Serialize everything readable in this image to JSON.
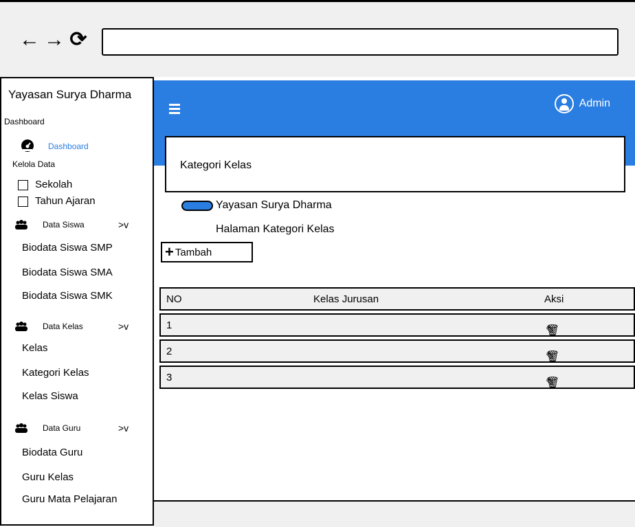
{
  "browser": {
    "back_icon": "←",
    "forward_icon": "→",
    "reload_icon": "⟳",
    "url": ""
  },
  "sidebar": {
    "brand": "Yayasan Surya Dharma",
    "section_dashboard": "Dashboard",
    "dashboard_link": "Dashboard",
    "section_kelola": "Kelola Data",
    "items_top": [
      "Sekolah",
      "Tahun Ajaran"
    ],
    "group_siswa": {
      "label": "Data Siswa",
      "chevron": ">v",
      "items": [
        "Biodata Siswa SMP",
        "Biodata Siswa SMA",
        "Biodata Siswa SMK"
      ]
    },
    "group_kelas": {
      "label": "Data Kelas",
      "chevron": ">v",
      "items": [
        "Kelas",
        "Kategori Kelas",
        "Kelas Siswa"
      ]
    },
    "group_guru": {
      "label": "Data Guru",
      "chevron": ">v",
      "items": [
        "Biodata Guru",
        "Guru Kelas",
        "Guru Mata Pelajaran"
      ]
    }
  },
  "header": {
    "admin_label": "Admin",
    "accent_color": "#2a7de1"
  },
  "page": {
    "title": "Kategori Kelas",
    "breadcrumb": [
      "Yayasan Surya Dharma",
      "Halaman Kategori Kelas"
    ],
    "add_button": "Tambah"
  },
  "table": {
    "headers": [
      "NO",
      "Kelas Jurusan",
      "Aksi"
    ],
    "rows": [
      {
        "no": "1",
        "kelas_jurusan": ""
      },
      {
        "no": "2",
        "kelas_jurusan": ""
      },
      {
        "no": "3",
        "kelas_jurusan": ""
      }
    ],
    "edit_icon": "✎",
    "delete_icon": "🗑"
  }
}
